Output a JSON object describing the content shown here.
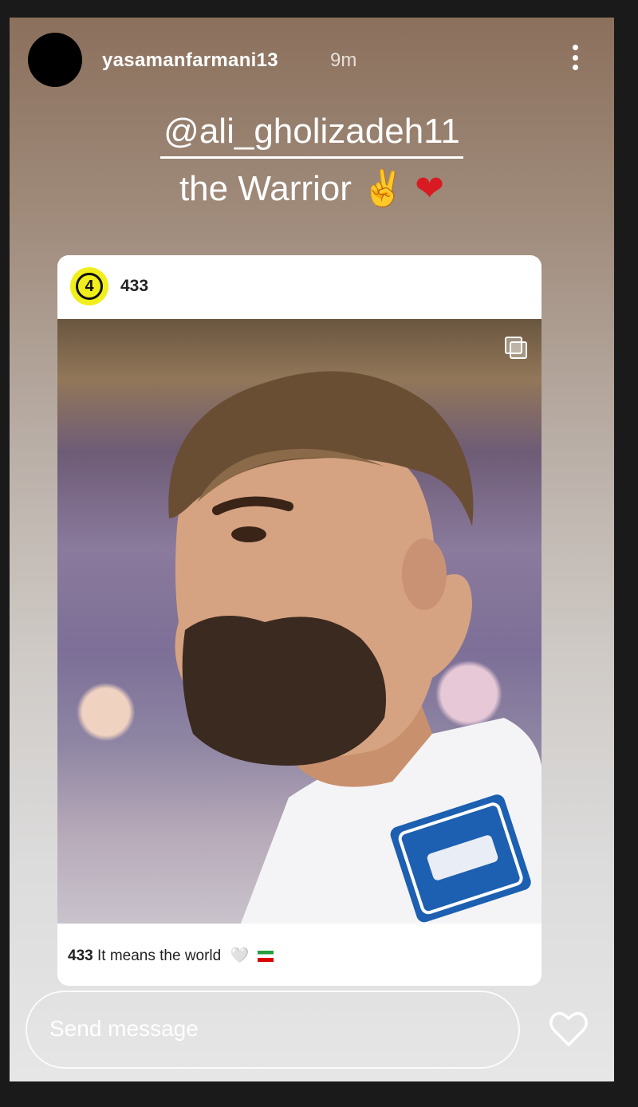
{
  "story": {
    "username": "yasamanfarmani13",
    "time_ago": "9m",
    "mention": "@ali_gholizadeh11",
    "caption_text": "the Warrior",
    "caption_emoji_v": "✌",
    "caption_emoji_heart": "❤"
  },
  "post": {
    "logo_text": "4",
    "author": "433",
    "caption_author": "433",
    "caption_text": "It means the world",
    "caption_emoji": "🤍"
  },
  "composer": {
    "placeholder": "Send message"
  },
  "icons": {
    "more": "more-vertical-icon",
    "like": "heart-outline-icon",
    "multi": "carousel-icon"
  }
}
